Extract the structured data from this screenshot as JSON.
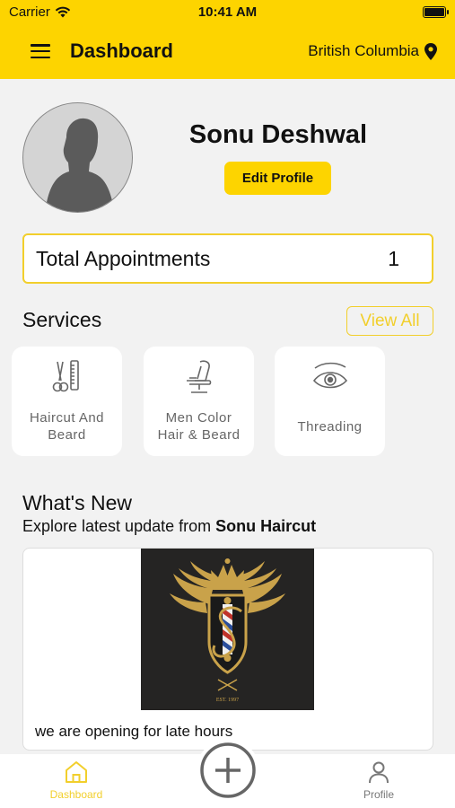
{
  "status_bar": {
    "carrier": "Carrier",
    "time": "10:41 AM"
  },
  "header": {
    "title": "Dashboard",
    "location": "British Columbia"
  },
  "profile": {
    "name": "Sonu Deshwal",
    "edit_label": "Edit Profile"
  },
  "appointments": {
    "label": "Total Appointments",
    "count": "1"
  },
  "services": {
    "title": "Services",
    "view_all": "View All",
    "items": [
      {
        "line1": "Haircut And",
        "line2": "Beard",
        "icon": "scissors-comb-icon"
      },
      {
        "line1": "Men Color",
        "line2": "Hair & Beard",
        "icon": "barber-chair-icon"
      },
      {
        "line1": "Threading",
        "icon": "eye-brow-icon"
      }
    ]
  },
  "whats_new": {
    "title": "What's New",
    "subtitle_prefix": "Explore latest update from ",
    "subtitle_brand": "Sonu Haircut",
    "post": {
      "caption": "we are opening for late hours",
      "logo_text": "EST. 1997"
    }
  },
  "bottom_nav": {
    "dashboard": "Dashboard",
    "profile": "Profile"
  },
  "colors": {
    "accent": "#fdd400",
    "outline_accent": "#f2cf2c",
    "gold": "#c9a24a"
  }
}
